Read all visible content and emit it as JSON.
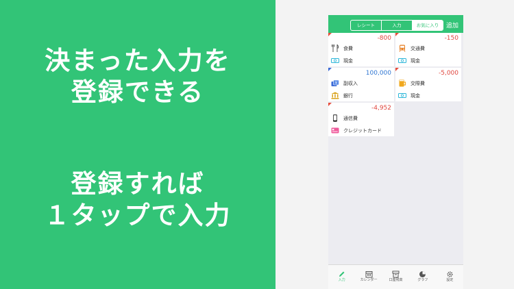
{
  "promo": {
    "caption1": [
      "決まった入力を",
      "登録できる"
    ],
    "caption2": [
      "登録すれば",
      "１タップで入力"
    ]
  },
  "navbar": {
    "segments": [
      {
        "label": "レシート",
        "active": false
      },
      {
        "label": "入力",
        "active": false
      },
      {
        "label": "お気に入り",
        "active": true
      }
    ],
    "add_label": "追加"
  },
  "favorites": [
    {
      "amount": "-800",
      "category": "食費",
      "category_icon": "fork-knife-icon",
      "account": "現金",
      "account_icon": "cash-icon",
      "marker": "red"
    },
    {
      "amount": "-150",
      "category": "交通費",
      "category_icon": "train-icon",
      "account": "現金",
      "account_icon": "cash-icon",
      "marker": "red"
    },
    {
      "amount": "100,000",
      "category": "副収入",
      "category_icon": "money-bag-icon",
      "account": "銀行",
      "account_icon": "bank-icon",
      "marker": "blue"
    },
    {
      "amount": "-5,000",
      "category": "交際費",
      "category_icon": "beer-icon",
      "account": "現金",
      "account_icon": "cash-icon",
      "marker": "red"
    },
    {
      "amount": "-4,952",
      "category": "通信費",
      "category_icon": "phone-icon",
      "account": "クレジットカード",
      "account_icon": "credit-card-icon",
      "marker": "red"
    }
  ],
  "tabbar": [
    {
      "label": "入力",
      "icon": "pencil-icon",
      "active": true
    },
    {
      "label": "カレンダー",
      "icon": "calendar-icon",
      "active": false
    },
    {
      "label": "口座残高",
      "icon": "balance-icon",
      "active": false
    },
    {
      "label": "グラフ",
      "icon": "pie-chart-icon",
      "active": false
    },
    {
      "label": "設定",
      "icon": "gear-icon",
      "active": false
    }
  ],
  "colors": {
    "brand_green": "#32c477",
    "expense_red": "#e0463e",
    "income_blue": "#2f76d2"
  }
}
